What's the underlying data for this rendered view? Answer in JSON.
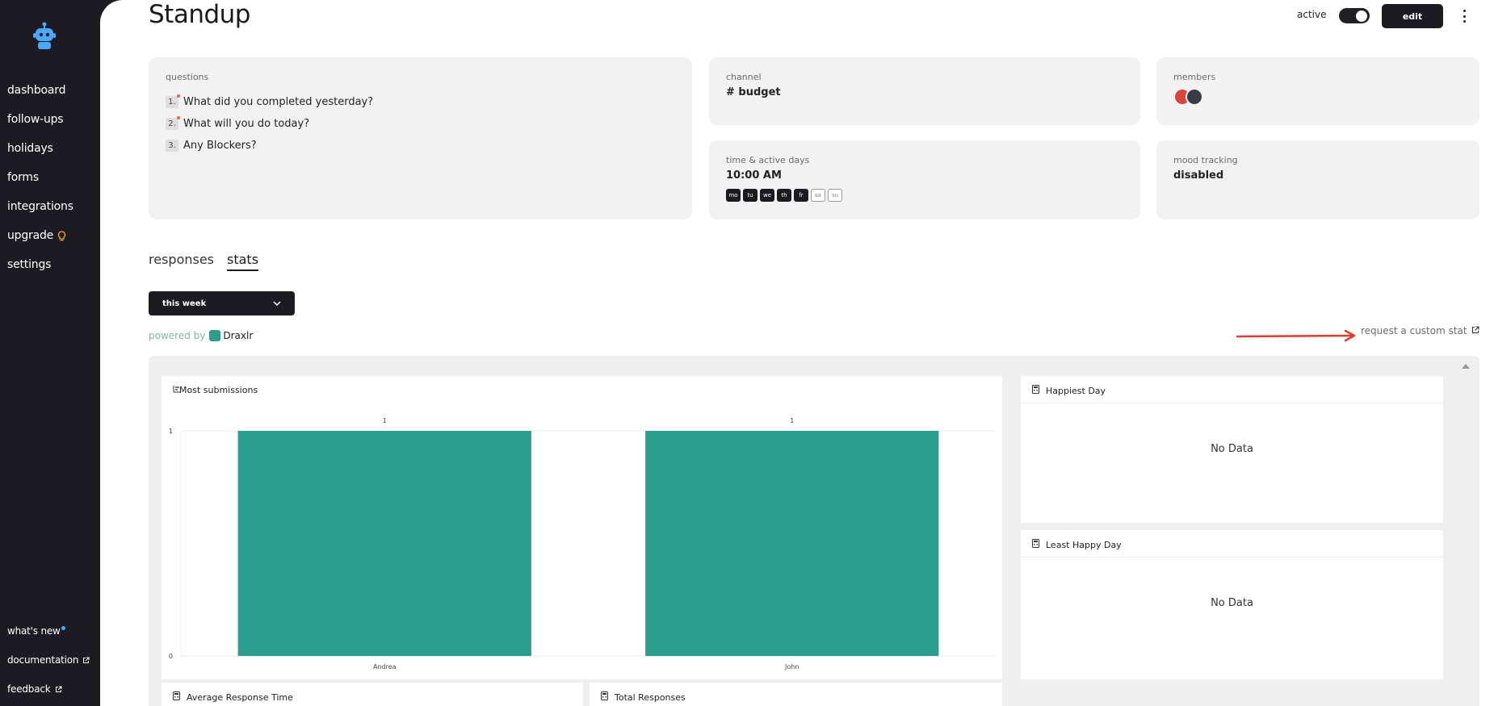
{
  "sidebar": {
    "items": [
      {
        "label": "dashboard"
      },
      {
        "label": "follow-ups"
      },
      {
        "label": "holidays"
      },
      {
        "label": "forms"
      },
      {
        "label": "integrations"
      },
      {
        "label": "upgrade",
        "icon": "lightbulb-icon"
      },
      {
        "label": "settings"
      }
    ],
    "bottom": [
      {
        "label": "what's new",
        "icon": "notification-dot"
      },
      {
        "label": "documentation",
        "icon": "external-link-icon"
      },
      {
        "label": "feedback",
        "icon": "external-link-icon"
      }
    ]
  },
  "header": {
    "title": "Standup",
    "active_label": "active",
    "active": true,
    "edit_label": "edit"
  },
  "cards": {
    "questions": {
      "label": "questions",
      "items": [
        {
          "num": "1.",
          "text": "What did you completed yesterday?"
        },
        {
          "num": "2.",
          "text": "What will you do today?"
        },
        {
          "num": "3.",
          "text": "Any Blockers?"
        }
      ]
    },
    "channel": {
      "label": "channel",
      "value": "# budget"
    },
    "members": {
      "label": "members"
    },
    "time": {
      "label": "time & active days",
      "value": "10:00 AM",
      "days": [
        {
          "abbr": "mo",
          "active": true
        },
        {
          "abbr": "tu",
          "active": true
        },
        {
          "abbr": "we",
          "active": true
        },
        {
          "abbr": "th",
          "active": true
        },
        {
          "abbr": "fr",
          "active": true
        },
        {
          "abbr": "sa",
          "active": false
        },
        {
          "abbr": "su",
          "active": false
        }
      ]
    },
    "mood": {
      "label": "mood tracking",
      "value": "disabled"
    }
  },
  "tabs": [
    {
      "label": "responses",
      "active": false
    },
    {
      "label": "stats",
      "active": true
    }
  ],
  "filter": {
    "selected": "this week"
  },
  "powered_by": {
    "prefix": "powered by",
    "brand": "Draxlr"
  },
  "custom_stat_link": "request a custom stat",
  "widgets": {
    "most_submissions": {
      "title": "Most submissions"
    },
    "happiest_day": {
      "title": "Happiest Day",
      "empty": "No Data"
    },
    "least_happy_day": {
      "title": "Least Happy Day",
      "empty": "No Data"
    },
    "avg_response_time": {
      "title": "Average Response Time"
    },
    "total_responses": {
      "title": "Total Responses"
    }
  },
  "colors": {
    "bar": "#2a9d8f",
    "accent": "#1c1b22",
    "annotation_arrow": "#e23b2e"
  },
  "chart_data": {
    "type": "bar",
    "title": "Most submissions",
    "categories": [
      "Andrea",
      "John"
    ],
    "values": [
      1,
      1
    ],
    "ylim": [
      0,
      1
    ],
    "yticks": [
      "0",
      "1"
    ],
    "data_labels": [
      "1",
      "1"
    ],
    "grid": true
  }
}
